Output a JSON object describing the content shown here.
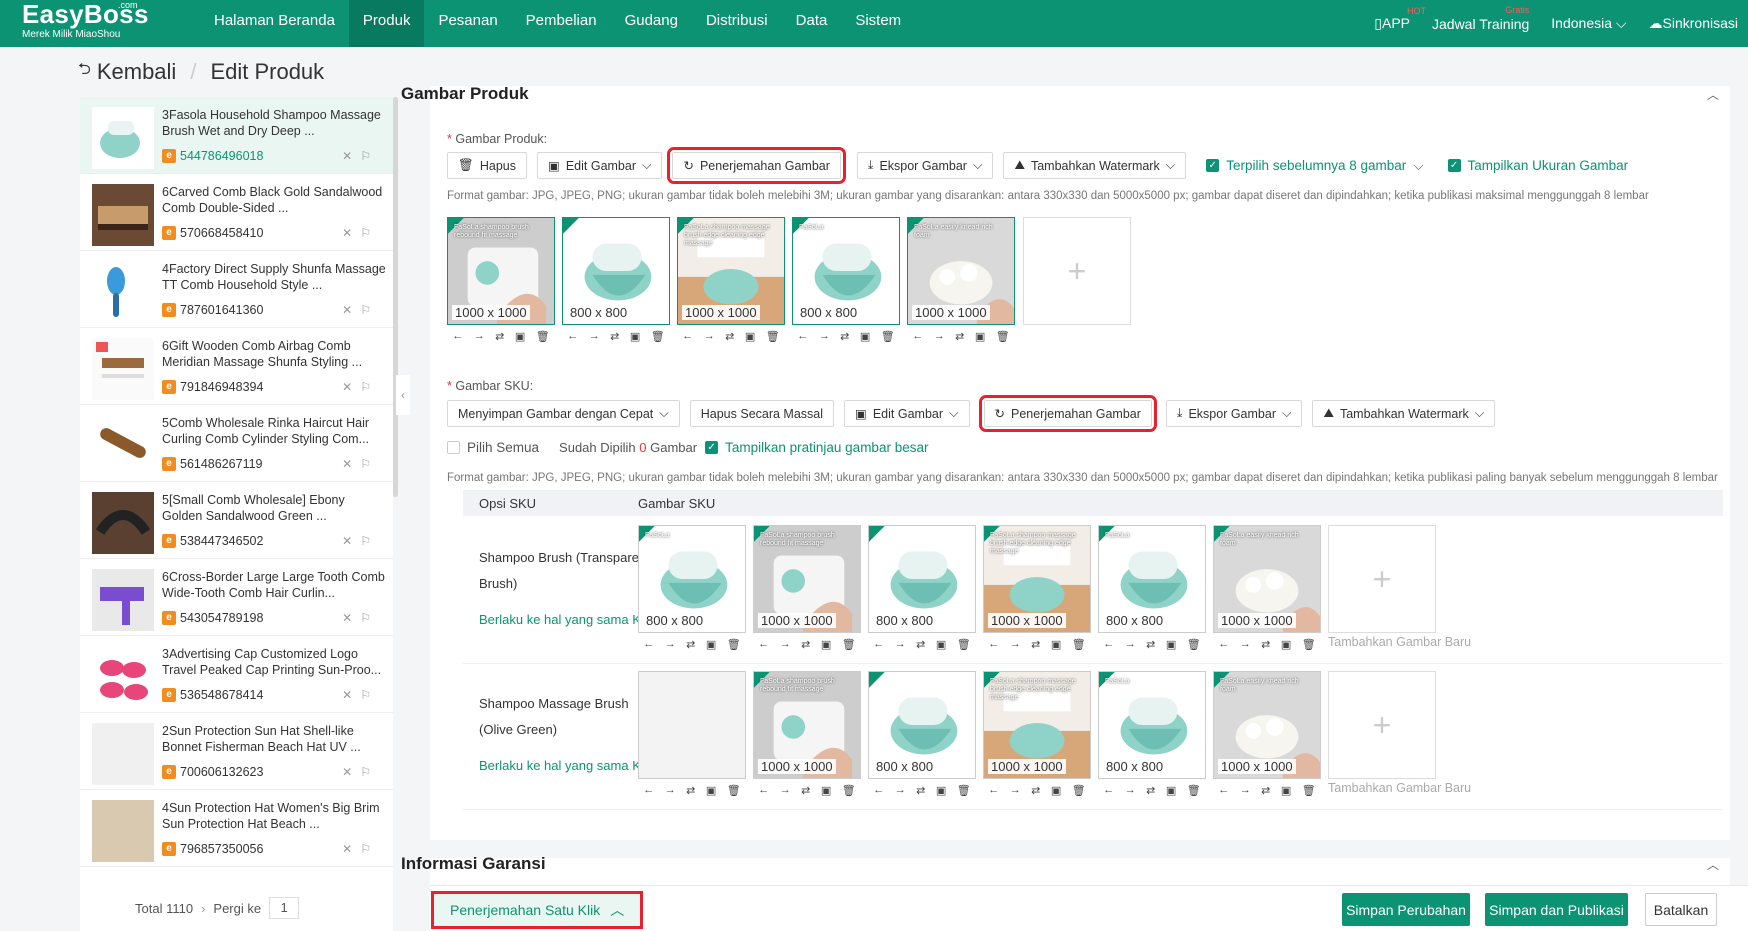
{
  "app": {
    "brand": "EasyBoss",
    "brand_suffix": ".com",
    "tagline": "Merek Milik MiaoShou"
  },
  "nav": [
    "Halaman Beranda",
    "Produk",
    "Pesanan",
    "Pembelian",
    "Gudang",
    "Distribusi",
    "Data",
    "Sistem"
  ],
  "topright": {
    "app": "APP",
    "app_badge": "HOT",
    "training": "Jadwal Training",
    "training_badge": "Gratis",
    "language": "Indonesia",
    "sync": "Sinkronisasi"
  },
  "breadcrumb": {
    "back": "Kembali",
    "current": "Edit Produk"
  },
  "products": [
    {
      "title": "3Fasola Household Shampoo Massage Brush Wet and Dry Deep ...",
      "id": "544786496018",
      "selected": true
    },
    {
      "title": "6Carved Comb Black Gold Sandalwood Comb Double-Sided ...",
      "id": "570668458410"
    },
    {
      "title": "4Factory Direct Supply Shunfa Massage TT Comb Household Style ...",
      "id": "787601641360"
    },
    {
      "title": "6Gift Wooden Comb Airbag Comb Meridian Massage Shunfa Styling ...",
      "id": "791846948394"
    },
    {
      "title": "5Comb Wholesale Rinka Haircut Hair Curling Comb Cylinder Styling Com...",
      "id": "561486267119"
    },
    {
      "title": "5[Small Comb Wholesale] Ebony Golden Sandalwood Green ...",
      "id": "538447346502"
    },
    {
      "title": "6Cross-Border Large Large Tooth Comb Wide-Tooth Comb Hair Curlin...",
      "id": "543054789198"
    },
    {
      "title": "3Advertising Cap Customized Logo Travel Peaked Cap Printing Sun-Proo...",
      "id": "536548678414"
    },
    {
      "title": "2Sun Protection Sun Hat Shell-like Bonnet Fisherman Beach Hat UV ...",
      "id": "700606132623"
    },
    {
      "title": "4Sun Protection Hat Women's Big Brim Sun Protection Hat Beach ...",
      "id": "796857350056"
    }
  ],
  "pagination": {
    "total": "Total 1110",
    "goto": "Pergi ke",
    "page": "1"
  },
  "gambar_produk": {
    "title": "Gambar Produk",
    "label": "Gambar Produk:",
    "buttons": {
      "hapus": "Hapus",
      "edit": "Edit Gambar",
      "translate": "Penerjemahan Gambar",
      "export": "Ekspor Gambar",
      "watermark": "Tambahkan Watermark"
    },
    "checks": {
      "selected": "Terpilih sebelumnya 8 gambar",
      "show_size": "Tampilkan Ukuran Gambar"
    },
    "hint": "Format gambar: JPG, JPEG, PNG; ukuran gambar tidak boleh melebihi 3M; ukuran gambar yang disarankan: antara 330x330 dan 5000x5000 px; gambar dapat diseret dan dipindahkan; ketika publikasi maksimal menggunggah 8 lembar",
    "images": [
      {
        "size": "1000 x 1000",
        "caption": "FaSoLa shampoo brush rebound fit massage",
        "kind": "hand"
      },
      {
        "size": "800 x 800",
        "caption": "",
        "kind": "brush"
      },
      {
        "size": "1000 x 1000",
        "caption": "FaSoLa shampoo massage brush edge cleaning edge massage",
        "kind": "bath"
      },
      {
        "size": "800 x 800",
        "caption": "FaSoLa",
        "kind": "brush"
      },
      {
        "size": "1000 x 1000",
        "caption": "FaSoLa easily knead rich foam",
        "kind": "foam"
      }
    ]
  },
  "gambar_sku": {
    "label": "Gambar SKU:",
    "buttons": {
      "save_quick": "Menyimpan Gambar dengan Cepat",
      "delete_bulk": "Hapus Secara Massal",
      "edit": "Edit Gambar",
      "translate": "Penerjemahan Gambar",
      "export": "Ekspor Gambar",
      "watermark": "Tambahkan Watermark"
    },
    "select_all": "Pilih Semua",
    "selected_prefix": "Sudah Dipilih",
    "selected_count": "0",
    "selected_suffix": "Gambar",
    "show_preview": "Tampilkan pratinjau gambar besar",
    "hint": "Format gambar: JPG, JPEG, PNG; ukuran gambar tidak boleh melebihi 3M; ukuran gambar yang disarankan: antara 330x330 dan 5000x5000 px; gambar dapat diseret dan dipindahkan; ketika publikasi paling banyak sebelum menggunggah 8 lembar",
    "col_option": "Opsi SKU",
    "col_image": "Gambar SKU",
    "add_new": "Tambahkan Gambar Baru",
    "apply_same": "Berlaku ke hal yang sama Keluaran",
    "rows": [
      {
        "name": "Shampoo Brush (Transparent Brush)",
        "images": [
          {
            "size": "800 x 800",
            "caption": "FaSoLa",
            "kind": "brush"
          },
          {
            "size": "1000 x 1000",
            "caption": "FaSoLa shampoo brush rebound fit massage",
            "kind": "hand"
          },
          {
            "size": "800 x 800",
            "caption": "",
            "kind": "brush"
          },
          {
            "size": "1000 x 1000",
            "caption": "FaSoLa shampoo massage brush edge cleaning edge massage",
            "kind": "bath"
          },
          {
            "size": "800 x 800",
            "caption": "FaSoLa",
            "kind": "brush"
          },
          {
            "size": "1000 x 1000",
            "caption": "FaSoLa easily knead rich foam",
            "kind": "foam"
          }
        ]
      },
      {
        "name": "Shampoo Massage Brush (Olive Green)",
        "images": [
          {
            "size": "",
            "caption": "",
            "kind": "empty"
          },
          {
            "size": "1000 x 1000",
            "caption": "FaSoLa shampoo brush rebound fit massage",
            "kind": "hand"
          },
          {
            "size": "800 x 800",
            "caption": "",
            "kind": "brush"
          },
          {
            "size": "1000 x 1000",
            "caption": "FaSoLa shampoo massage brush edge cleaning edge massage",
            "kind": "bath"
          },
          {
            "size": "800 x 800",
            "caption": "FaSoLa",
            "kind": "brush"
          },
          {
            "size": "1000 x 1000",
            "caption": "FaSoLa easily knead rich foam",
            "kind": "foam"
          }
        ]
      }
    ]
  },
  "garansi_title": "Informasi Garansi",
  "bottom": {
    "translate_all": "Penerjemahan Satu Klik",
    "save": "Simpan Perubahan",
    "save_publish": "Simpan dan Publikasi",
    "cancel": "Batalkan"
  },
  "colors": {
    "primary": "#0b9373",
    "highlight": "#e8212f",
    "brush_teal": "#8fd3c8"
  }
}
